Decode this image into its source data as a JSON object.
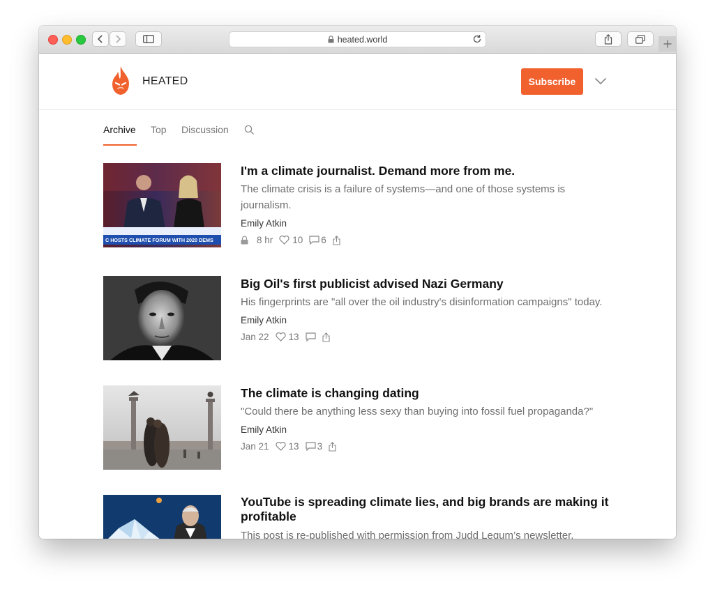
{
  "browser": {
    "url": "heated.world"
  },
  "site": {
    "name": "HEATED",
    "subscribe_label": "Subscribe",
    "brand_color": "#f0612e"
  },
  "tabs": [
    {
      "label": "Archive",
      "active": true
    },
    {
      "label": "Top",
      "active": false
    },
    {
      "label": "Discussion",
      "active": false
    }
  ],
  "posts": [
    {
      "title": "I'm a climate journalist. Demand more from me.",
      "subtitle": "The climate crisis is a failure of systems—and one of those systems is journalism.",
      "author": "Emily Atkin",
      "date": "8 hr",
      "likes": "10",
      "comments": "6",
      "paywalled": true,
      "thumb_caption": "C HOSTS CLIMATE FORUM WITH 2020 DEMS"
    },
    {
      "title": "Big Oil's first publicist advised Nazi Germany",
      "subtitle": "His fingerprints are \"all over the oil industry's disinformation campaigns\" today.",
      "author": "Emily Atkin",
      "date": "Jan 22",
      "likes": "13",
      "comments": ""
    },
    {
      "title": "The climate is changing dating",
      "subtitle": "\"Could there be anything less sexy than buying into fossil fuel propaganda?\"",
      "author": "Emily Atkin",
      "date": "Jan 21",
      "likes": "13",
      "comments": "3"
    },
    {
      "title": "YouTube is spreading climate lies, and big brands are making it profitable",
      "subtitle": "This post is re-published with permission from Judd Legum’s newsletter,"
    }
  ]
}
